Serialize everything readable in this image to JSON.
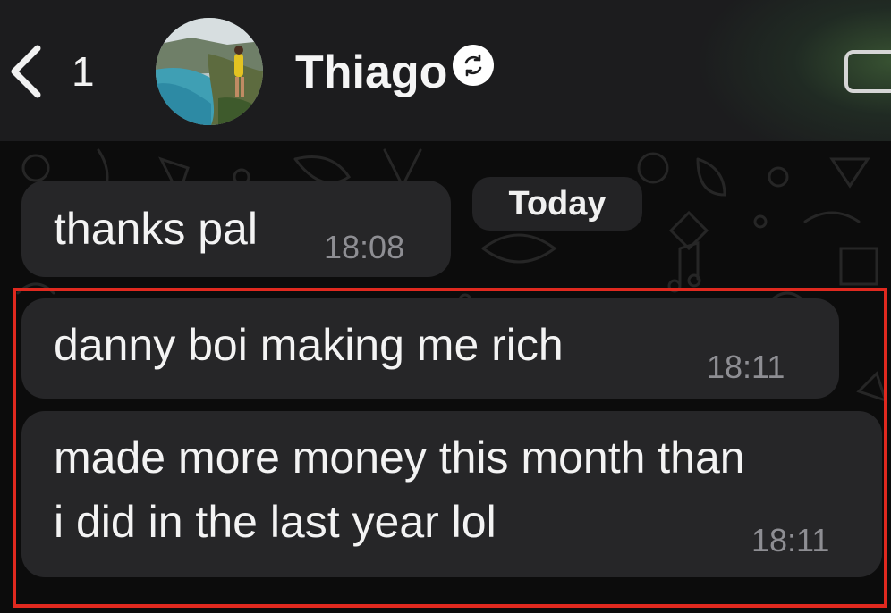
{
  "header": {
    "back_count": "1",
    "contact_name": "Thiago",
    "icons": {
      "back": "chevron-left-icon",
      "sync": "sync-icon",
      "video": "video-call-icon"
    }
  },
  "chat": {
    "date_chip": "Today",
    "messages": [
      {
        "text": "thanks pal",
        "time": "18:08"
      },
      {
        "text": "danny boi making me rich",
        "time": "18:11"
      },
      {
        "text_lines": [
          "made more money this month than",
          "i did in the last year lol"
        ],
        "time": "18:11"
      }
    ]
  },
  "colors": {
    "header_bg": "#1c1c1e",
    "bubble_bg": "#262628",
    "time_text": "#8e8e93",
    "highlight_border": "#e0291f"
  }
}
